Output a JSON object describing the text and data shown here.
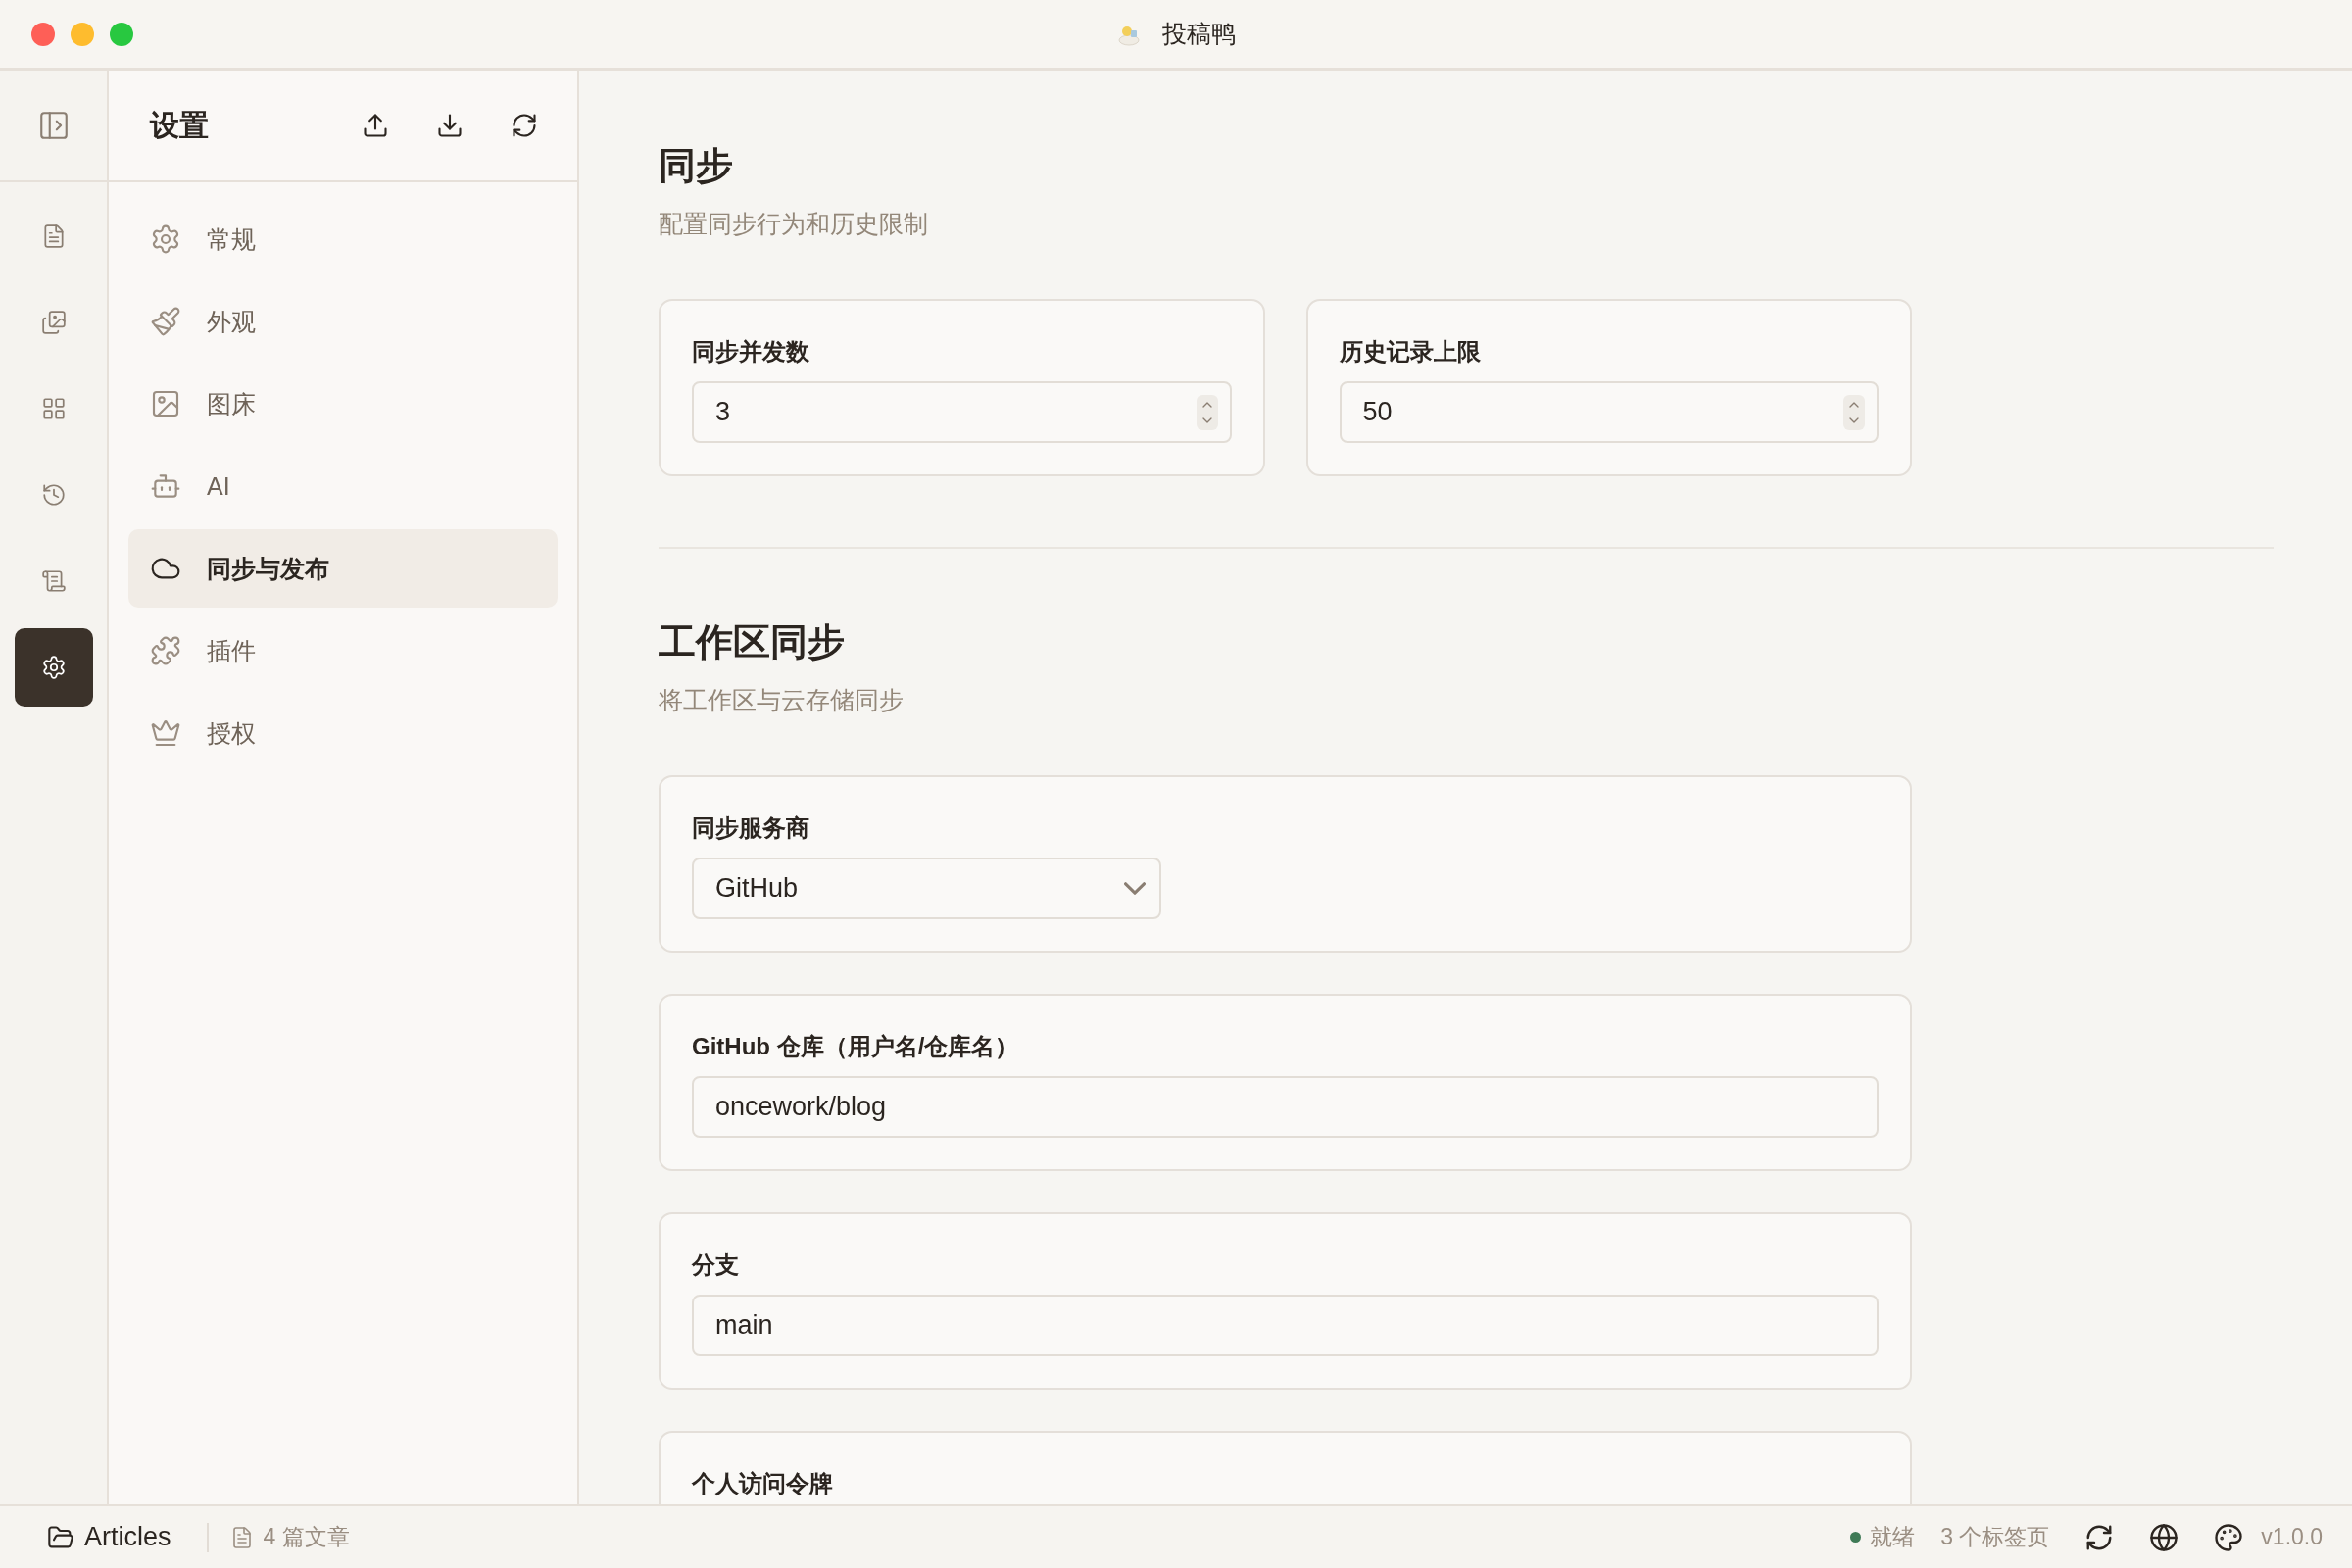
{
  "window": {
    "title": "投稿鸭"
  },
  "rail": {
    "items": [
      {
        "selected": false
      },
      {
        "selected": false
      },
      {
        "selected": false
      },
      {
        "selected": false
      },
      {
        "selected": false
      },
      {
        "selected": true
      }
    ]
  },
  "settings_panel": {
    "title": "设置",
    "items": [
      {
        "label": "常规",
        "selected": false
      },
      {
        "label": "外观",
        "selected": false
      },
      {
        "label": "图床",
        "selected": false
      },
      {
        "label": "AI",
        "selected": false
      },
      {
        "label": "同步与发布",
        "selected": true
      },
      {
        "label": "插件",
        "selected": false
      },
      {
        "label": "授权",
        "selected": false
      }
    ]
  },
  "sections": [
    {
      "title": "同步",
      "subtitle": "配置同步行为和历史限制",
      "cards": [
        {
          "label": "同步并发数",
          "kind": "number",
          "value": "3"
        },
        {
          "label": "历史记录上限",
          "kind": "number",
          "value": "50"
        }
      ]
    },
    {
      "title": "工作区同步",
      "subtitle": "将工作区与云存储同步",
      "cards": [
        {
          "label": "同步服务商",
          "kind": "select",
          "value": "GitHub"
        },
        {
          "label": "GitHub 仓库（用户名/仓库名）",
          "kind": "text",
          "value": "oncework/blog"
        },
        {
          "label": "分支",
          "kind": "text",
          "value": "main"
        },
        {
          "label": "个人访问令牌"
        }
      ]
    }
  ],
  "status_bar": {
    "folder": "Articles",
    "count": "4 篇文章",
    "status": {
      "label": "就绪",
      "color": "#3f7a56"
    },
    "tabs": "3 个标签页",
    "version": "v1.0.0"
  }
}
